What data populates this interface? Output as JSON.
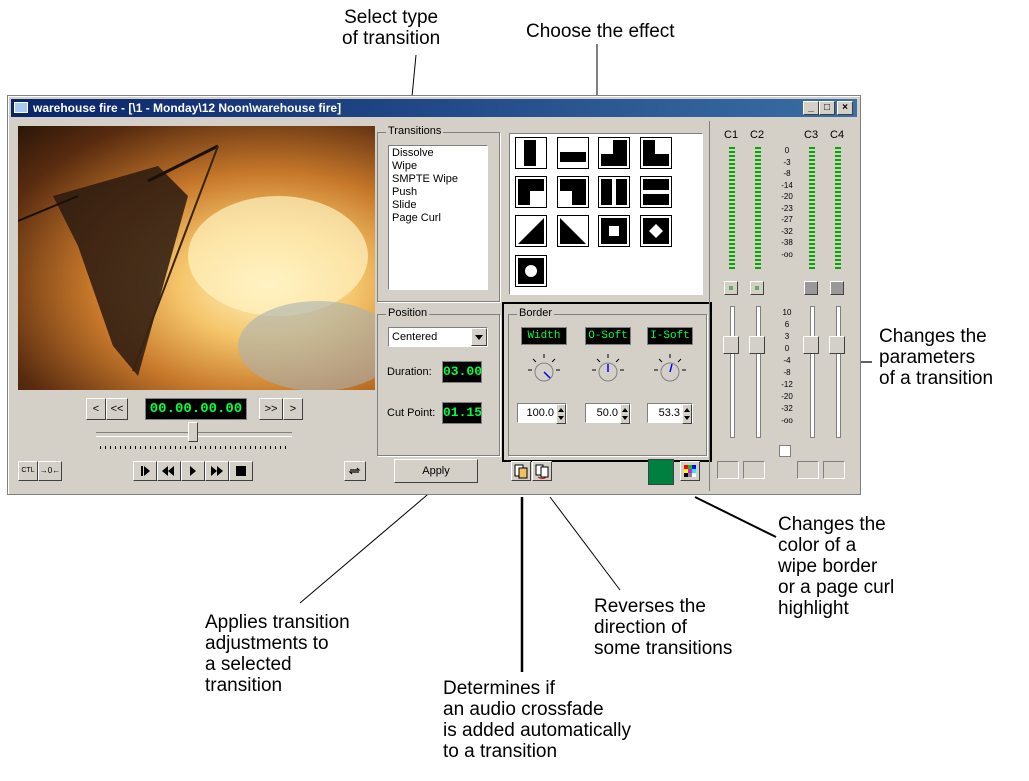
{
  "callouts": {
    "select_type": "Select type\nof transition",
    "choose_effect": "Choose the effect",
    "changes_params": "Changes the\nparameters\nof a transition",
    "changes_color": "Changes the\ncolor of a\nwipe border\nor a page curl\nhighlight",
    "reverses": "Reverses the\ndirection of\nsome transitions",
    "applies": "Applies transition\nadjustments to\na selected\ntransition",
    "crossfade": "Determines if\nan audio crossfade\nis added automatically\nto a transition"
  },
  "window": {
    "title": "warehouse fire - [\\1 - Monday\\12 Noon\\warehouse fire]",
    "min": "_",
    "max": "□",
    "close": "×"
  },
  "transitions": {
    "label": "Transitions",
    "items": [
      "Dissolve",
      "Wipe",
      "SMPTE Wipe",
      "Push",
      "Slide",
      "Page Curl"
    ]
  },
  "position": {
    "label": "Position",
    "selected": "Centered",
    "duration_label": "Duration:",
    "duration_value": "03.00",
    "cutpoint_label": "Cut Point:",
    "cutpoint_value": "01.15"
  },
  "border": {
    "label": "Border",
    "width_label": "Width",
    "osoft_label": "O-Soft",
    "isoft_label": "I-Soft",
    "width_value": "100.0",
    "osoft_value": "50.0",
    "isoft_value": "53.3"
  },
  "transport": {
    "timecode": "00.00.00.00",
    "prev": "<",
    "rew": "<<",
    "ff": ">>",
    "next": ">",
    "ctl": "CTL",
    "zero": "→0←",
    "apply": "Apply"
  },
  "audio": {
    "channels": [
      "C1",
      "C2",
      "C3",
      "C4"
    ],
    "scale_top": [
      "0",
      "-3",
      "-8",
      "-14",
      "-20",
      "-23",
      "-27",
      "-32",
      "-38",
      "-oo"
    ],
    "scale_fader": [
      "10",
      "6",
      "3",
      "0",
      "-4",
      "-8",
      "-12",
      "-20",
      "-32",
      "-oo"
    ]
  },
  "colors": {
    "border_color": "#008040",
    "lcd_text": "#00ff40"
  }
}
